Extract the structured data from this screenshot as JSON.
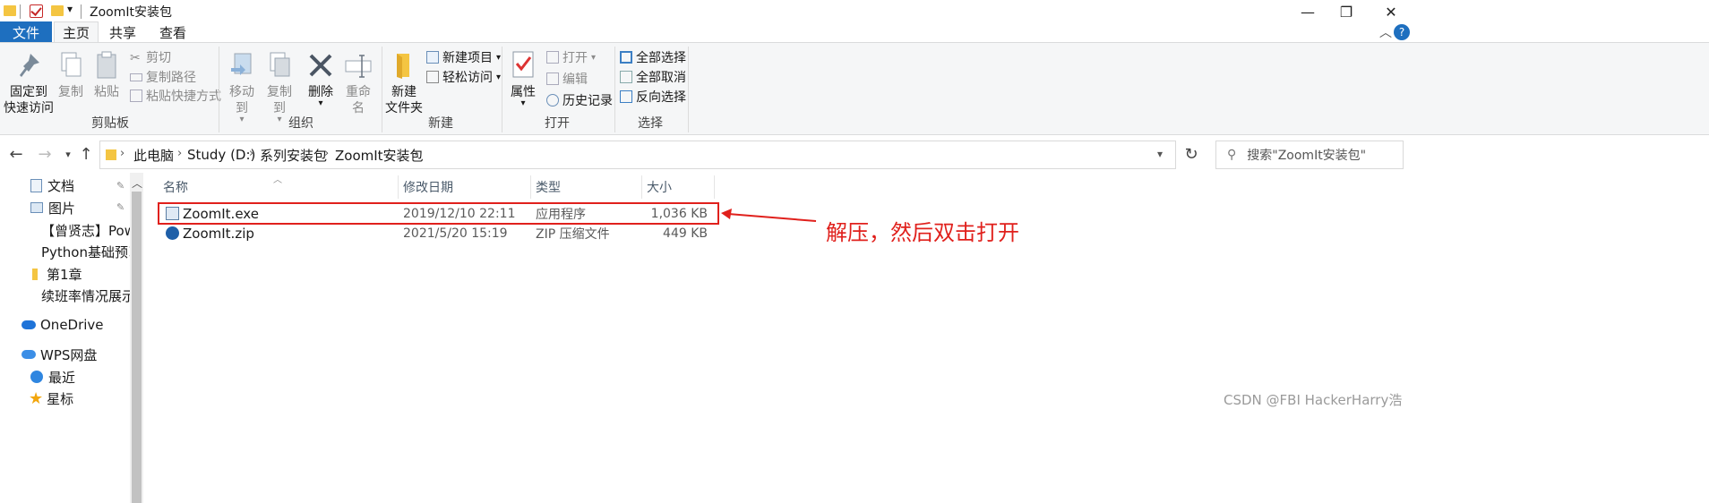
{
  "window": {
    "title": "ZoomIt安装包",
    "minimize_glyph": "—",
    "restore_glyph": "❐",
    "close_glyph": "✕"
  },
  "tabs": {
    "file": "文件",
    "home": "主页",
    "share": "共享",
    "view": "查看"
  },
  "ribbon": {
    "clipboard": {
      "label": "剪贴板",
      "pin_line1": "固定到",
      "pin_line2": "快速访问",
      "copy": "复制",
      "paste": "粘贴",
      "cut": "剪切",
      "copy_path": "复制路径",
      "paste_shortcut": "粘贴快捷方式"
    },
    "organize": {
      "label": "组织",
      "move_to": "移动到",
      "copy_to": "复制到",
      "delete": "删除",
      "rename": "重命名"
    },
    "new": {
      "label": "新建",
      "new_folder_line1": "新建",
      "new_folder_line2": "文件夹",
      "new_item": "新建项目",
      "easy_access": "轻松访问"
    },
    "open": {
      "label": "打开",
      "properties": "属性",
      "open": "打开",
      "edit": "编辑",
      "history": "历史记录"
    },
    "select": {
      "label": "选择",
      "select_all": "全部选择",
      "select_none": "全部取消",
      "invert": "反向选择"
    }
  },
  "address": {
    "crumbs": [
      "此电脑",
      "Study (D:)",
      "系列安装包",
      "ZoomIt安装包"
    ]
  },
  "search": {
    "placeholder": "搜索\"ZoomIt安装包\""
  },
  "navpane": {
    "items": [
      {
        "label": "文档",
        "icon": "document-icon",
        "pinned": true
      },
      {
        "label": "图片",
        "icon": "picture-icon",
        "pinned": true
      },
      {
        "label": "【曾贤志】Powe",
        "icon": "folder-icon",
        "pinned": false
      },
      {
        "label": "Python基础预习",
        "icon": "folder-icon",
        "pinned": false
      },
      {
        "label": "第1章",
        "icon": "folder-icon",
        "pinned": false
      },
      {
        "label": "续班率情况展示",
        "icon": "folder-icon",
        "pinned": false
      },
      {
        "label": "OneDrive",
        "icon": "cloud-icon",
        "pinned": false
      },
      {
        "label": "WPS网盘",
        "icon": "cloud-icon",
        "pinned": false
      },
      {
        "label": "最近",
        "icon": "clock-icon",
        "pinned": false
      },
      {
        "label": "星标",
        "icon": "star-icon",
        "pinned": false
      }
    ]
  },
  "filelist": {
    "columns": {
      "name": "名称",
      "modified": "修改日期",
      "type": "类型",
      "size": "大小"
    },
    "rows": [
      {
        "name": "ZoomIt.exe",
        "modified": "2019/12/10 22:11",
        "type": "应用程序",
        "size": "1,036 KB",
        "icon": "exe-icon"
      },
      {
        "name": "ZoomIt.zip",
        "modified": "2021/5/20 15:19",
        "type": "ZIP 压缩文件",
        "size": "449 KB",
        "icon": "zip-icon"
      }
    ]
  },
  "annotation": {
    "text": "解压，然后双击打开",
    "color": "#e0201c"
  },
  "watermark": "CSDN @FBI HackerHarry浩",
  "colors": {
    "accent": "#1e6fbf",
    "highlight": "#e0201c",
    "folder": "#f4c542"
  }
}
